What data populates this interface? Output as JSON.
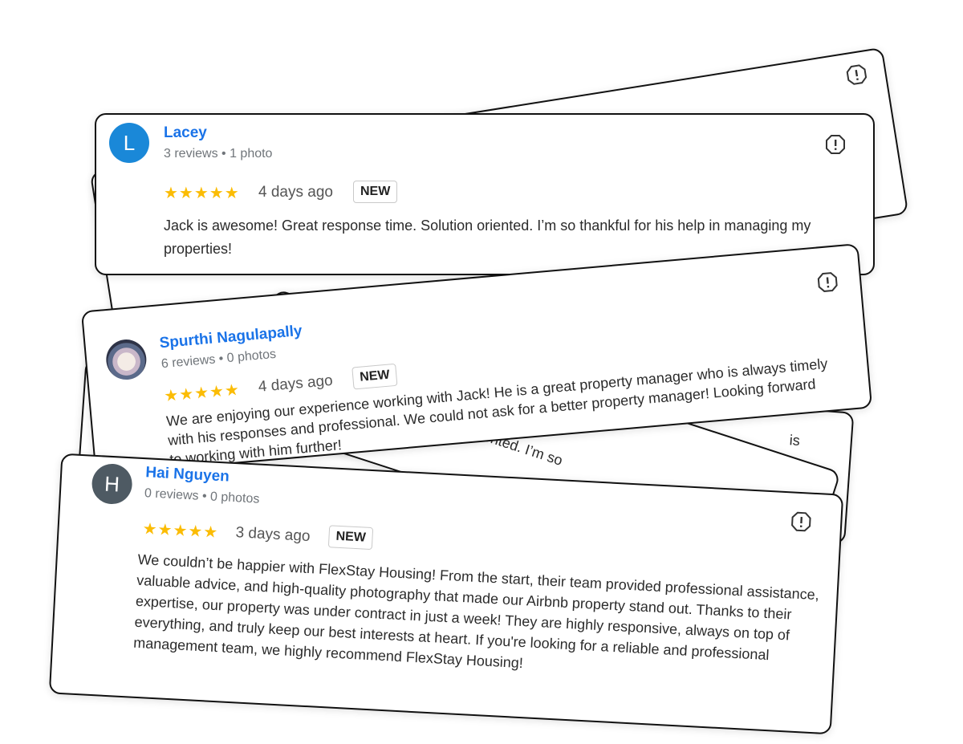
{
  "flag_icon": "report-flag-icon",
  "colors": {
    "accent": "#1a73e8",
    "star": "#fbbc04",
    "avatar_blue": "#1a88d8",
    "avatar_dark": "#4e5a63"
  },
  "reviews": [
    {
      "avatar_letter": "L",
      "name": "Lacey",
      "meta": "3 reviews • 1 photo",
      "stars": "★★★★★",
      "time": "4 days ago",
      "badge": "NEW",
      "text": "Jack is awesome! Great response time. Solution oriented. I’m so thankful for his help in managing my properties!"
    },
    {
      "avatar_letter": "",
      "name": "Spurthi Nagulapally",
      "meta": "6 reviews • 0 photos",
      "stars": "★★★★★",
      "time": "4 days ago",
      "badge": "NEW",
      "text": "We are enjoying our experience working with Jack! He is a great property manager who is always timely with his responses and professional. We could not ask for a better property manager! Looking forward to working with him further!"
    },
    {
      "avatar_letter": "H",
      "name": "Hai Nguyen",
      "meta": "0 reviews • 0 photos",
      "stars": "★★★★★",
      "time": "3 days ago",
      "badge": "NEW",
      "text": "We couldn’t be happier with FlexStay Housing! From the start, their team provided professional assistance, valuable advice, and high-quality photography that made our Airbnb property stand out. Thanks to their expertise, our property was under contract in just a week! They are highly responsive, always on top of everything, and truly keep our best interests at heart. If you're looking for a reliable and professional management team, we highly recommend FlexStay Housing!"
    }
  ],
  "background_snippets": [
    "oriented. I’m so",
    "is"
  ]
}
